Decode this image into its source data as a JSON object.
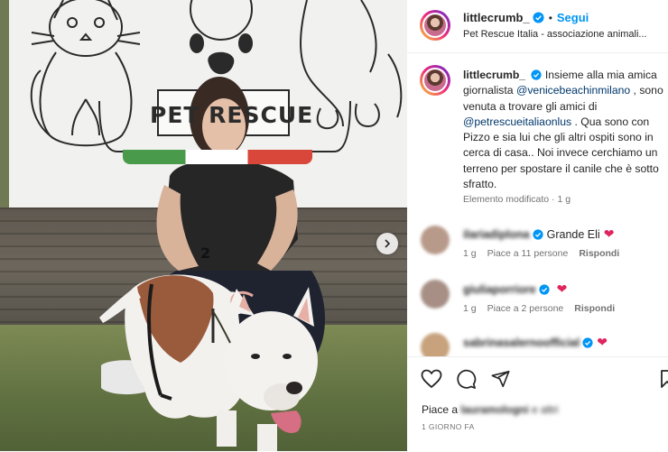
{
  "post": {
    "username": "littlecrumb_",
    "follow_label": "Segui",
    "separator": "•",
    "location": "Pet Rescue Italia - associazione animali...",
    "banner_logo_text": "PET RESCUE",
    "caption": {
      "username": "littlecrumb_",
      "part1": "Insieme alla mia amica giornalista ",
      "mention1": "@venicebeachinmilano",
      "part2": " , sono venuta a trovare gli amici di ",
      "mention2": "@petrescueitaliaonlus",
      "part3": " . Qua sono con Pizzo e sia lui che gli altri ospiti sono in cerca di casa.. Noi invece cerchiamo un terreno per spostare il canile che è sotto sfratto."
    },
    "edited_meta": "Elemento modificato · 1 g"
  },
  "comments": [
    {
      "username": "ilariadiplona",
      "text": "Grande Eli",
      "time": "1 g",
      "likes": "Piace a 11 persone",
      "reply": "Rispondi",
      "avatar_color": "#b89a8a"
    },
    {
      "username": "giuliaporriore",
      "text": "",
      "time": "1 g",
      "likes": "Piace a 2 persone",
      "reply": "Rispondi",
      "avatar_color": "#a78f86"
    },
    {
      "username": "sabrinasalernoofficial",
      "text": "",
      "time": "",
      "likes": "",
      "reply": "",
      "avatar_color": "#c7a27c"
    }
  ],
  "actions": {
    "liked_by_prefix": "Piace a ",
    "liked_by_name": "lauramologni",
    "liked_by_suffix": " e altri",
    "date": "1 GIORNO FA"
  },
  "colors": {
    "accent": "#0095f6",
    "mention": "#00376b",
    "secondary_text": "#737373",
    "heart": "#e0245e"
  }
}
